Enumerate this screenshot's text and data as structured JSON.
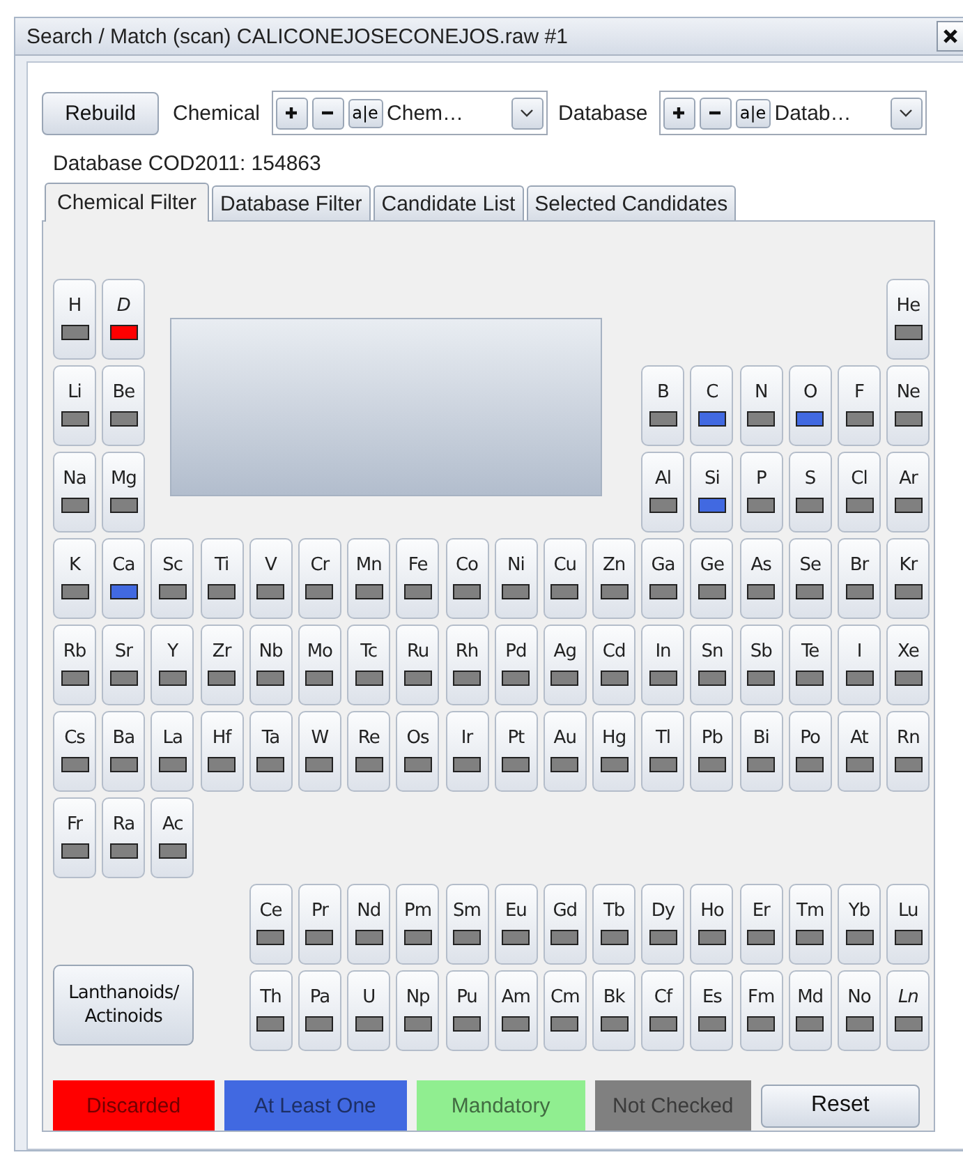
{
  "window": {
    "title": "Search / Match (scan) CALICONEJOSECONEJOS.raw #1"
  },
  "toolbar": {
    "rebuild": "Rebuild",
    "combos": [
      {
        "label": "Chemical",
        "edit": "a|e",
        "value": "Chem…"
      },
      {
        "label": "Database",
        "edit": "a|e",
        "value": "Datab…"
      }
    ]
  },
  "status": "Database COD2011: 154863",
  "tabs": [
    {
      "label": "Chemical Filter",
      "selected": true
    },
    {
      "label": "Database Filter",
      "selected": false
    },
    {
      "label": "Candidate List",
      "selected": false
    },
    {
      "label": "Selected Candidates",
      "selected": false
    }
  ],
  "periodic": {
    "rows": [
      {
        "left": [
          {
            "symbol": "H",
            "italic": false,
            "color": "#808080"
          },
          {
            "symbol": "D",
            "italic": true,
            "color": "#ff0000"
          }
        ],
        "right": [
          {
            "symbol": "He",
            "italic": false,
            "color": "#808080"
          }
        ]
      },
      {
        "left": [
          {
            "symbol": "Li",
            "italic": false,
            "color": "#808080"
          },
          {
            "symbol": "Be",
            "italic": false,
            "color": "#808080"
          }
        ],
        "right": [
          {
            "symbol": "B",
            "italic": false,
            "color": "#808080"
          },
          {
            "symbol": "C",
            "italic": false,
            "color": "#4169e1"
          },
          {
            "symbol": "N",
            "italic": false,
            "color": "#808080"
          },
          {
            "symbol": "O",
            "italic": false,
            "color": "#4169e1"
          },
          {
            "symbol": "F",
            "italic": false,
            "color": "#808080"
          },
          {
            "symbol": "Ne",
            "italic": false,
            "color": "#808080"
          }
        ]
      },
      {
        "left": [
          {
            "symbol": "Na",
            "italic": false,
            "color": "#808080"
          },
          {
            "symbol": "Mg",
            "italic": false,
            "color": "#808080"
          }
        ],
        "right": [
          {
            "symbol": "Al",
            "italic": false,
            "color": "#808080"
          },
          {
            "symbol": "Si",
            "italic": false,
            "color": "#4169e1"
          },
          {
            "symbol": "P",
            "italic": false,
            "color": "#808080"
          },
          {
            "symbol": "S",
            "italic": false,
            "color": "#808080"
          },
          {
            "symbol": "Cl",
            "italic": false,
            "color": "#808080"
          },
          {
            "symbol": "Ar",
            "italic": false,
            "color": "#808080"
          }
        ]
      },
      {
        "left": [
          {
            "symbol": "K",
            "italic": false,
            "color": "#808080"
          },
          {
            "symbol": "Ca",
            "italic": false,
            "color": "#4169e1"
          },
          {
            "symbol": "Sc",
            "italic": false,
            "color": "#808080"
          },
          {
            "symbol": "Ti",
            "italic": false,
            "color": "#808080"
          },
          {
            "symbol": "V",
            "italic": false,
            "color": "#808080"
          },
          {
            "symbol": "Cr",
            "italic": false,
            "color": "#808080"
          },
          {
            "symbol": "Mn",
            "italic": false,
            "color": "#808080"
          },
          {
            "symbol": "Fe",
            "italic": false,
            "color": "#808080"
          },
          {
            "symbol": "Co",
            "italic": false,
            "color": "#808080"
          },
          {
            "symbol": "Ni",
            "italic": false,
            "color": "#808080"
          },
          {
            "symbol": "Cu",
            "italic": false,
            "color": "#808080"
          },
          {
            "symbol": "Zn",
            "italic": false,
            "color": "#808080"
          },
          {
            "symbol": "Ga",
            "italic": false,
            "color": "#808080"
          },
          {
            "symbol": "Ge",
            "italic": false,
            "color": "#808080"
          },
          {
            "symbol": "As",
            "italic": false,
            "color": "#808080"
          },
          {
            "symbol": "Se",
            "italic": false,
            "color": "#808080"
          },
          {
            "symbol": "Br",
            "italic": false,
            "color": "#808080"
          },
          {
            "symbol": "Kr",
            "italic": false,
            "color": "#808080"
          }
        ],
        "right": []
      },
      {
        "left": [
          {
            "symbol": "Rb",
            "italic": false,
            "color": "#808080"
          },
          {
            "symbol": "Sr",
            "italic": false,
            "color": "#808080"
          },
          {
            "symbol": "Y",
            "italic": false,
            "color": "#808080"
          },
          {
            "symbol": "Zr",
            "italic": false,
            "color": "#808080"
          },
          {
            "symbol": "Nb",
            "italic": false,
            "color": "#808080"
          },
          {
            "symbol": "Mo",
            "italic": false,
            "color": "#808080"
          },
          {
            "symbol": "Tc",
            "italic": false,
            "color": "#808080"
          },
          {
            "symbol": "Ru",
            "italic": false,
            "color": "#808080"
          },
          {
            "symbol": "Rh",
            "italic": false,
            "color": "#808080"
          },
          {
            "symbol": "Pd",
            "italic": false,
            "color": "#808080"
          },
          {
            "symbol": "Ag",
            "italic": false,
            "color": "#808080"
          },
          {
            "symbol": "Cd",
            "italic": false,
            "color": "#808080"
          },
          {
            "symbol": "In",
            "italic": false,
            "color": "#808080"
          },
          {
            "symbol": "Sn",
            "italic": false,
            "color": "#808080"
          },
          {
            "symbol": "Sb",
            "italic": false,
            "color": "#808080"
          },
          {
            "symbol": "Te",
            "italic": false,
            "color": "#808080"
          },
          {
            "symbol": "I",
            "italic": false,
            "color": "#808080"
          },
          {
            "symbol": "Xe",
            "italic": false,
            "color": "#808080"
          }
        ],
        "right": []
      },
      {
        "left": [
          {
            "symbol": "Cs",
            "italic": false,
            "color": "#808080"
          },
          {
            "symbol": "Ba",
            "italic": false,
            "color": "#808080"
          },
          {
            "symbol": "La",
            "italic": false,
            "color": "#808080"
          },
          {
            "symbol": "Hf",
            "italic": false,
            "color": "#808080"
          },
          {
            "symbol": "Ta",
            "italic": false,
            "color": "#808080"
          },
          {
            "symbol": "W",
            "italic": false,
            "color": "#808080"
          },
          {
            "symbol": "Re",
            "italic": false,
            "color": "#808080"
          },
          {
            "symbol": "Os",
            "italic": false,
            "color": "#808080"
          },
          {
            "symbol": "Ir",
            "italic": false,
            "color": "#808080"
          },
          {
            "symbol": "Pt",
            "italic": false,
            "color": "#808080"
          },
          {
            "symbol": "Au",
            "italic": false,
            "color": "#808080"
          },
          {
            "symbol": "Hg",
            "italic": false,
            "color": "#808080"
          },
          {
            "symbol": "Tl",
            "italic": false,
            "color": "#808080"
          },
          {
            "symbol": "Pb",
            "italic": false,
            "color": "#808080"
          },
          {
            "symbol": "Bi",
            "italic": false,
            "color": "#808080"
          },
          {
            "symbol": "Po",
            "italic": false,
            "color": "#808080"
          },
          {
            "symbol": "At",
            "italic": false,
            "color": "#808080"
          },
          {
            "symbol": "Rn",
            "italic": false,
            "color": "#808080"
          }
        ],
        "right": []
      },
      {
        "left": [
          {
            "symbol": "Fr",
            "italic": false,
            "color": "#808080"
          },
          {
            "symbol": "Ra",
            "italic": false,
            "color": "#808080"
          },
          {
            "symbol": "Ac",
            "italic": false,
            "color": "#808080"
          }
        ],
        "right": []
      },
      {
        "left": [],
        "right": [
          {
            "symbol": "Ce",
            "italic": false,
            "color": "#808080"
          },
          {
            "symbol": "Pr",
            "italic": false,
            "color": "#808080"
          },
          {
            "symbol": "Nd",
            "italic": false,
            "color": "#808080"
          },
          {
            "symbol": "Pm",
            "italic": false,
            "color": "#808080"
          },
          {
            "symbol": "Sm",
            "italic": false,
            "color": "#808080"
          },
          {
            "symbol": "Eu",
            "italic": false,
            "color": "#808080"
          },
          {
            "symbol": "Gd",
            "italic": false,
            "color": "#808080"
          },
          {
            "symbol": "Tb",
            "italic": false,
            "color": "#808080"
          },
          {
            "symbol": "Dy",
            "italic": false,
            "color": "#808080"
          },
          {
            "symbol": "Ho",
            "italic": false,
            "color": "#808080"
          },
          {
            "symbol": "Er",
            "italic": false,
            "color": "#808080"
          },
          {
            "symbol": "Tm",
            "italic": false,
            "color": "#808080"
          },
          {
            "symbol": "Yb",
            "italic": false,
            "color": "#808080"
          },
          {
            "symbol": "Lu",
            "italic": false,
            "color": "#808080"
          }
        ]
      },
      {
        "left": [],
        "right": [
          {
            "symbol": "Th",
            "italic": false,
            "color": "#808080"
          },
          {
            "symbol": "Pa",
            "italic": false,
            "color": "#808080"
          },
          {
            "symbol": "U",
            "italic": false,
            "color": "#808080"
          },
          {
            "symbol": "Np",
            "italic": false,
            "color": "#808080"
          },
          {
            "symbol": "Pu",
            "italic": false,
            "color": "#808080"
          },
          {
            "symbol": "Am",
            "italic": false,
            "color": "#808080"
          },
          {
            "symbol": "Cm",
            "italic": false,
            "color": "#808080"
          },
          {
            "symbol": "Bk",
            "italic": false,
            "color": "#808080"
          },
          {
            "symbol": "Cf",
            "italic": false,
            "color": "#808080"
          },
          {
            "symbol": "Es",
            "italic": false,
            "color": "#808080"
          },
          {
            "symbol": "Fm",
            "italic": false,
            "color": "#808080"
          },
          {
            "symbol": "Md",
            "italic": false,
            "color": "#808080"
          },
          {
            "symbol": "No",
            "italic": false,
            "color": "#808080"
          },
          {
            "symbol": "Ln",
            "italic": true,
            "color": "#808080"
          }
        ]
      }
    ],
    "series_button": "Lanthanoids/\nActinoids"
  },
  "legend": [
    {
      "label": "Discarded",
      "color": "#ff0000"
    },
    {
      "label": "At Least One",
      "color": "#4169e1"
    },
    {
      "label": "Mandatory",
      "color": "#90ee90"
    },
    {
      "label": "Not Checked",
      "color": "#808080"
    }
  ],
  "reset": "Reset"
}
